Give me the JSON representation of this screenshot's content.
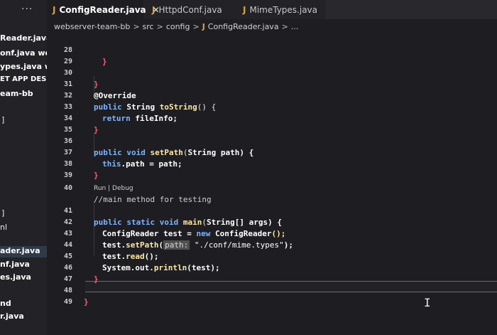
{
  "tabs": [
    {
      "icon": "J",
      "label": "ConfigReader.java",
      "active": true,
      "close": "✕"
    },
    {
      "icon": "J",
      "label": "HttpdConf.java",
      "active": false
    },
    {
      "icon": "J",
      "label": "MimeTypes.java",
      "active": false
    }
  ],
  "more": "···",
  "breadcrumb": {
    "project": "webserver-team-bb",
    "folder1": "src",
    "folder2": "config",
    "file_icon": "J",
    "file": "ConfigReader.java",
    "tail": "...",
    "sep": ">"
  },
  "sidebar": {
    "items": [
      "Reader.java...",
      "onf.java we...",
      "ypes.java w...",
      "ET APP DESI...",
      "eam-bb",
      "",
      "",
      "",
      "ader.java",
      "nf.java",
      "es.java",
      "nd",
      "r.java"
    ]
  },
  "editor": {
    "lines": [
      {
        "n": "28"
      },
      {
        "n": "29"
      },
      {
        "n": "30"
      },
      {
        "n": "31"
      },
      {
        "n": "32"
      },
      {
        "n": "33"
      },
      {
        "n": "34"
      },
      {
        "n": "35"
      },
      {
        "n": "36"
      },
      {
        "n": "37"
      },
      {
        "n": "38"
      },
      {
        "n": "39"
      },
      {
        "n": "40"
      },
      {
        "n": "41"
      },
      {
        "n": "42"
      },
      {
        "n": "43"
      },
      {
        "n": "44"
      },
      {
        "n": "45"
      },
      {
        "n": "46"
      },
      {
        "n": "47"
      },
      {
        "n": "48"
      },
      {
        "n": "49"
      }
    ],
    "codelens": "Run | Debug",
    "code": {
      "l28": "}",
      "l30": "}",
      "l31": "@Override",
      "l32_kw": "public",
      "l32_type": "String",
      "l32_fn": "toString",
      "l32_rest": "() {",
      "l33_kw": "return",
      "l33_rest": "fileInfo;",
      "l34": "}",
      "l36_kw1": "public",
      "l36_kw2": "void",
      "l36_fn": "setPath",
      "l36_rest1": "(",
      "l36_type": "String",
      "l36_rest2": "path) {",
      "l37_kw": "this",
      "l37_rest": ".path = path;",
      "l38": "}",
      "l40": "//main method for testing",
      "l41_kw1": "public",
      "l41_kw2": "static",
      "l41_kw3": "void",
      "l41_fn": "main",
      "l41_rest1": "(",
      "l41_type": "String[]",
      "l41_rest2": "args) {",
      "l42_type": "ConfigReader",
      "l42_mid": "test =",
      "l42_kw": "new",
      "l42_type2": "ConfigReader",
      "l42_rest": "();",
      "l43_pre": "test.",
      "l43_fn": "setPath",
      "l43_open": "(",
      "l43_hint": "path:",
      "l43_str": "\"./conf/mime.types\"",
      "l43_rest": ");",
      "l44_pre": "test.",
      "l44_fn": "read",
      "l44_rest": "();",
      "l45_pre": "System.out.",
      "l45_fn": "println",
      "l45_rest": "(test);",
      "l46": "}",
      "l48": "}"
    }
  },
  "cursor_glyph": "I"
}
